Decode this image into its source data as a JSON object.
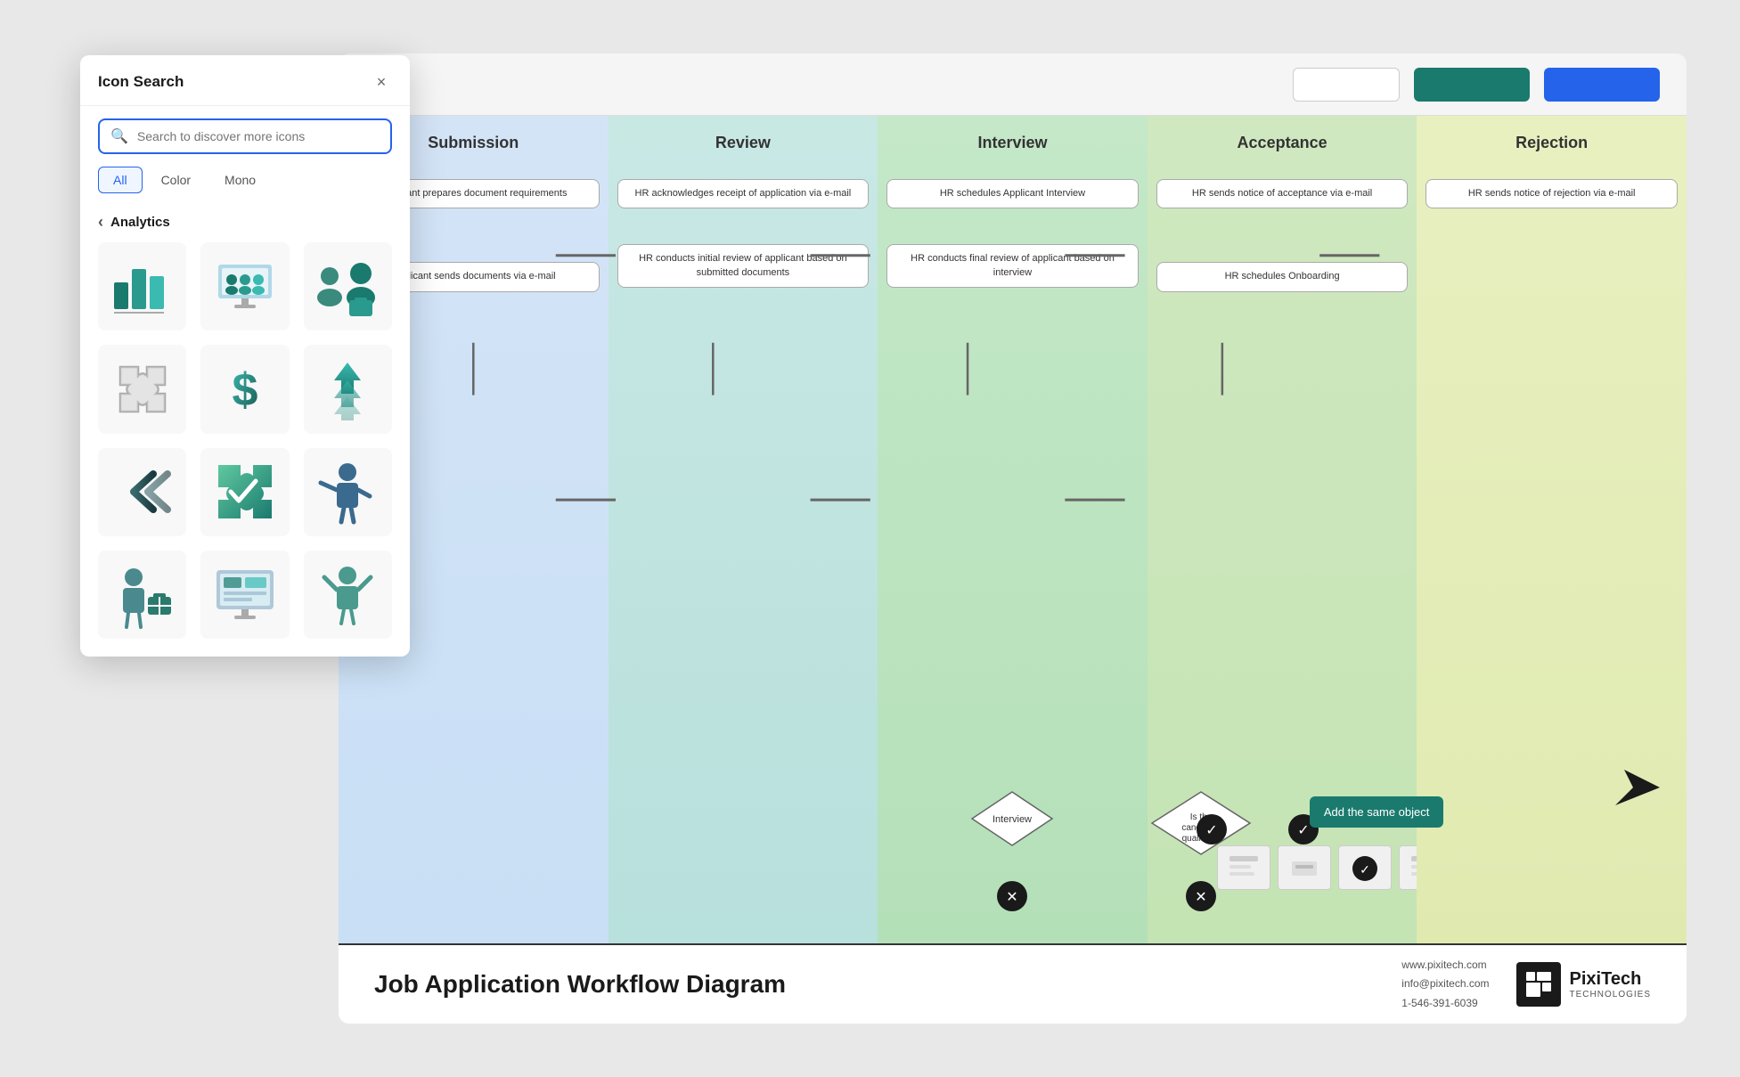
{
  "panel": {
    "title": "Icon Search",
    "close_label": "×",
    "search_placeholder": "Search to discover more icons",
    "filters": [
      {
        "label": "All",
        "active": true
      },
      {
        "label": "Color",
        "active": false
      },
      {
        "label": "Mono",
        "active": false
      }
    ],
    "category": "Analytics",
    "icons": [
      {
        "name": "bar-chart",
        "type": "color"
      },
      {
        "name": "team-meeting",
        "type": "color"
      },
      {
        "name": "people-group",
        "type": "color"
      },
      {
        "name": "puzzle-mono",
        "type": "mono"
      },
      {
        "name": "dollar-sign",
        "type": "color"
      },
      {
        "name": "upload-arrows",
        "type": "color"
      },
      {
        "name": "double-chevron",
        "type": "mono"
      },
      {
        "name": "puzzle-check",
        "type": "color"
      },
      {
        "name": "presenter",
        "type": "color"
      },
      {
        "name": "worker",
        "type": "color"
      },
      {
        "name": "dashboard",
        "type": "color"
      },
      {
        "name": "success-person",
        "type": "color"
      }
    ]
  },
  "toolbar": {
    "input_placeholder": "",
    "btn_teal_label": "",
    "btn_blue_label": ""
  },
  "diagram": {
    "title": "Job Application Workflow Diagram",
    "footer_contact": "www.pixitech.com\ninfo@pixitech.com\n1-546-391-6039",
    "logo_name": "PixiTech",
    "logo_subtitle": "TECHNOLOGIES",
    "columns": [
      {
        "id": "submission",
        "label": "Submission"
      },
      {
        "id": "review",
        "label": "Review"
      },
      {
        "id": "interview",
        "label": "Interview"
      },
      {
        "id": "acceptance",
        "label": "Acceptance"
      },
      {
        "id": "rejection",
        "label": "Rejection"
      }
    ],
    "boxes": {
      "submission_1": "Applicant prepares document requirements",
      "submission_2": "Applicant sends documents via e-mail",
      "review_1": "HR acknowledges receipt of application via e-mail",
      "review_2": "HR conducts initial review of applicant based on submitted documents",
      "interview_1": "HR schedules Applicant Interview",
      "interview_2": "HR conducts final review of applicant based on interview",
      "acceptance_1": "HR sends notice of acceptance via e-mail",
      "acceptance_2": "HR schedules Onboarding",
      "rejection_1": "HR sends notice of rejection via e-mail",
      "diamond_1": "Interview",
      "diamond_2": "Is the candidate qualified?"
    },
    "add_button_label": "Add the same object"
  }
}
